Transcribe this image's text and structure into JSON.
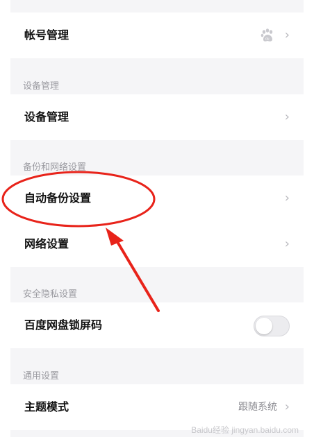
{
  "account_section": {
    "item_label": "帐号管理",
    "icon": "baidu-paw-icon"
  },
  "device_section": {
    "title": "设备管理",
    "item_label": "设备管理"
  },
  "backup_section": {
    "title": "备份和网络设置",
    "auto_backup_label": "自动备份设置",
    "network_label": "网络设置"
  },
  "privacy_section": {
    "title": "安全隐私设置",
    "lock_label": "百度网盘锁屏码",
    "lock_enabled": false
  },
  "general_section": {
    "title": "通用设置",
    "theme_label": "主题模式",
    "theme_value": "跟随系统"
  },
  "watermark": "Baidu经验 jingyan.baidu.com",
  "colors": {
    "annotation": "#e8231a",
    "background": "#f5f5f7",
    "row": "#ffffff"
  }
}
